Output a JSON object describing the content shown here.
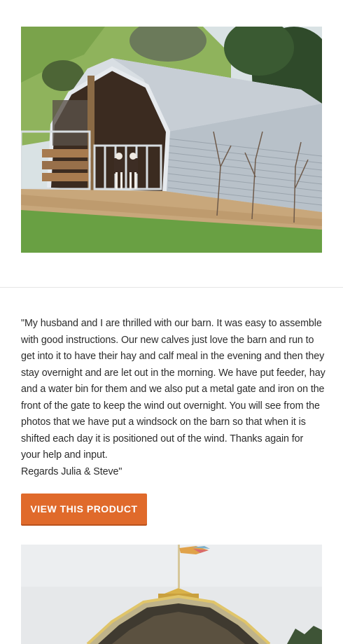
{
  "images": {
    "top_photo_alt": "Curved-roof corrugated barn on a hillside with two goats inside",
    "bottom_photo_alt": "Front of timber-framed barn with a windsock on top"
  },
  "testimonial": {
    "lines": [
      "\"My husband and I are thrilled with our barn. It was easy to assemble",
      "with good instructions. Our new calves just love the barn and run to",
      "get into it to have their hay and calf meal in the evening and then they",
      "stay overnight and are let out in the morning. We have put feeder, hay",
      "and a water bin for them and we also put a metal gate and iron on the",
      "front of the gate to keep the wind out overnight. You will see from the",
      "photos that we have put a windsock on the barn so that when it is",
      "shifted each day it is positioned out of the wind. Thanks again for",
      "your help and input.",
      "Regards Julia & Steve\""
    ]
  },
  "cta": {
    "label": "VIEW THIS PRODUCT"
  },
  "colors": {
    "accent": "#e06a2b",
    "text": "#2b2b2b",
    "divider": "#e6e6e6"
  }
}
